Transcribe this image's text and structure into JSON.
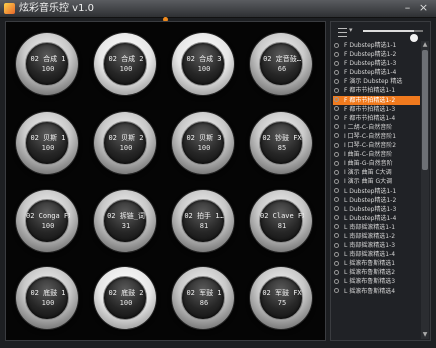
{
  "window": {
    "title": "炫彩音乐控 v1.0",
    "minimize_label": "–",
    "close_label": "×"
  },
  "pads": [
    {
      "label": "02 合成 1",
      "value": "100"
    },
    {
      "label": "02 合成 2",
      "value": "100"
    },
    {
      "label": "02 合成 3",
      "value": "100"
    },
    {
      "label": "02 定音鼓…",
      "value": "66"
    },
    {
      "label": "02 贝斯 1",
      "value": "100"
    },
    {
      "label": "02 贝斯 2",
      "value": "100"
    },
    {
      "label": "02 贝斯 3",
      "value": "100"
    },
    {
      "label": "02 钞鼓 FX",
      "value": "85"
    },
    {
      "label": "02 Conga FX",
      "value": "100"
    },
    {
      "label": "02 拆链_词",
      "value": "31"
    },
    {
      "label": "02 拍手 1…",
      "value": "81"
    },
    {
      "label": "02 Clave FX",
      "value": "81"
    },
    {
      "label": "02 底鼓 1",
      "value": "100"
    },
    {
      "label": "02 底鼓 2",
      "value": "100"
    },
    {
      "label": "02 军鼓 1",
      "value": "86"
    },
    {
      "label": "02 军鼓 FX",
      "value": "75"
    }
  ],
  "playlist": [
    "F Dubstep精选1-1",
    "F Dubstep精选1-2",
    "F Dubstep精选1-3",
    "F Dubstep精选1-4",
    "F 演示 Dubstep 精选",
    "F 都市节拍精选1-1",
    "F 都市节拍精选1-2",
    "F 都市节拍精选1-3",
    "F 都市节拍精选1-4",
    "I 二胡-C-自然音阶",
    "I 口琴-C-自然音阶1",
    "I 口琴-C-自然音阶2",
    "I 曲笛-C-自然音阶",
    "I 曲笛-G-自然音阶",
    "I 演示 曲笛 C大调",
    "I 演示 曲笛 G大调",
    "L Dubstep精选1-1",
    "L Dubstep精选1-2",
    "L Dubstep精选1-3",
    "L Dubstep精选1-4",
    "L 南部摇滚精选1-1",
    "L 南部摇滚精选1-2",
    "L 南部摇滚精选1-3",
    "L 南部摇滚精选1-4",
    "L 摇滚布鲁斯精选1",
    "L 摇滚布鲁斯精选2",
    "L 摇滚布鲁斯精选3",
    "L 摇滚布鲁斯精选4"
  ],
  "playlist_active_index": 6,
  "volume": 0.85,
  "colors": {
    "accent": "#f07a1e"
  },
  "icons": {
    "menu": "menu-icon",
    "app": "app-icon"
  }
}
